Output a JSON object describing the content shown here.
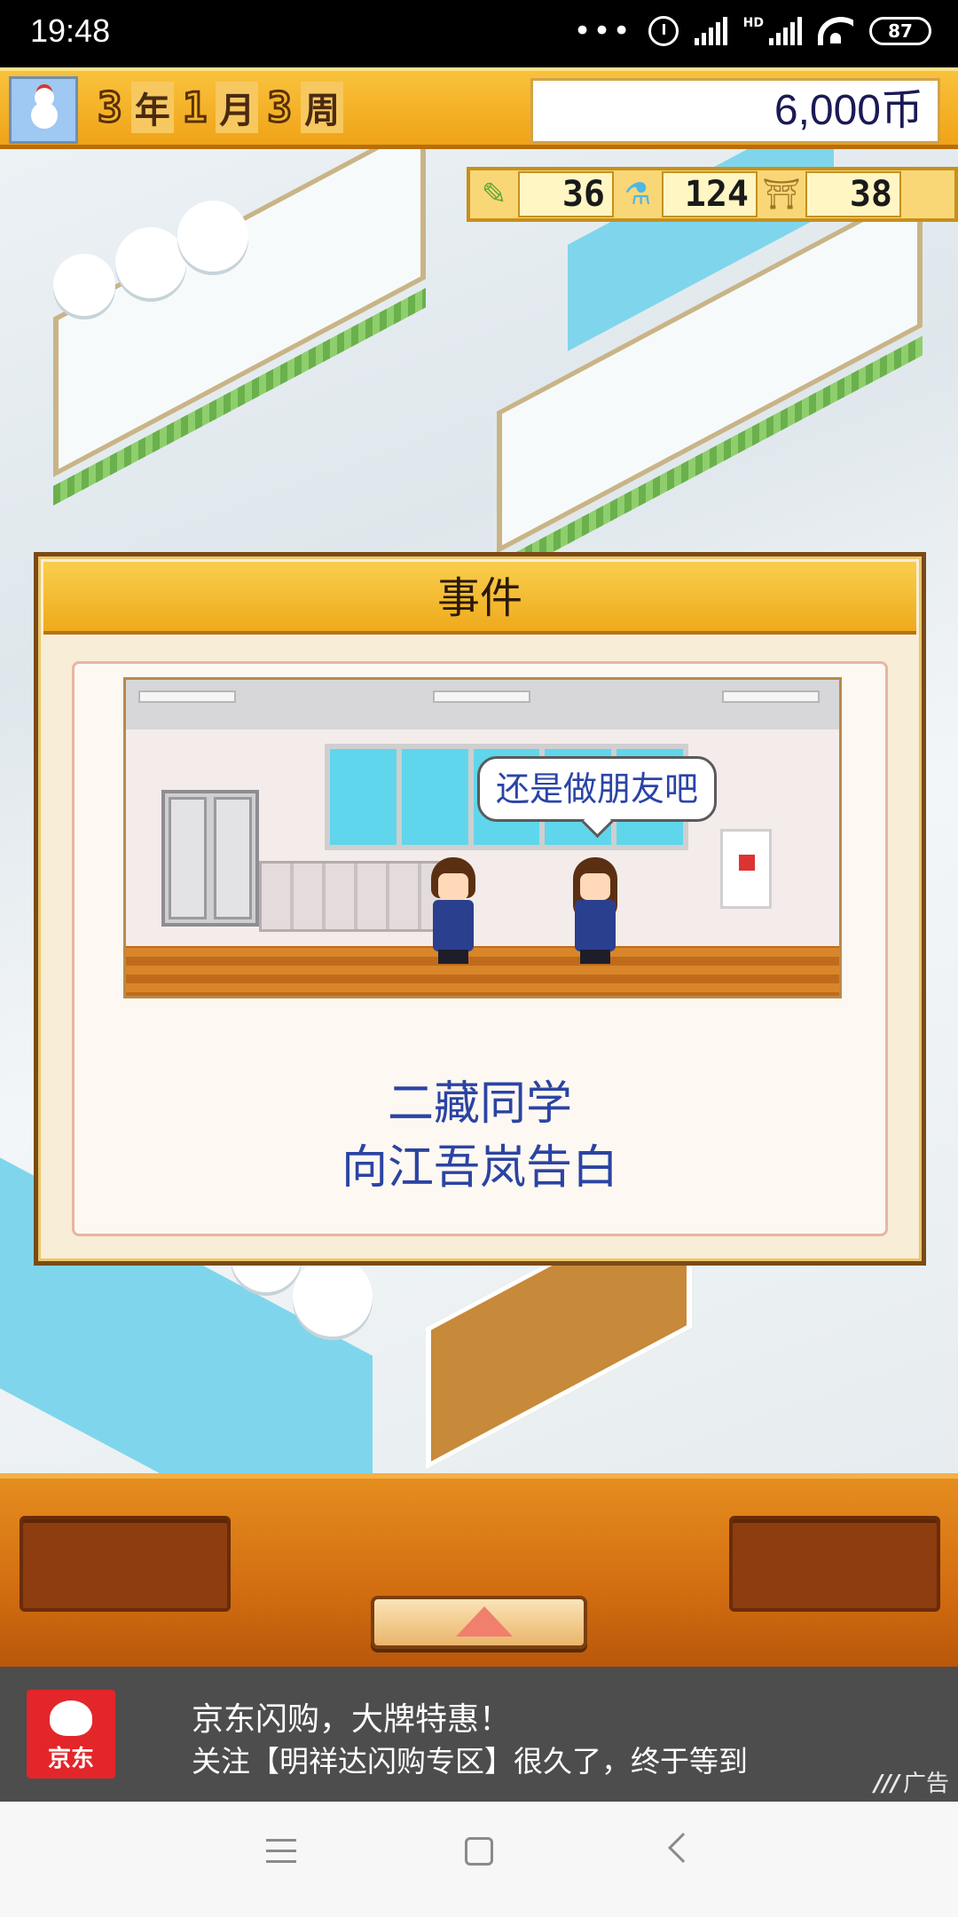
{
  "status_bar": {
    "time": "19:48",
    "battery": "87",
    "network_label": "HD",
    "icons": [
      "more-dots-icon",
      "alarm-icon",
      "signal-icon",
      "signal-hd-icon",
      "wifi-icon",
      "battery-icon"
    ]
  },
  "hud": {
    "avatar_icon": "snowman-icon",
    "date": {
      "year": "3",
      "year_unit": "年",
      "month": "1",
      "month_unit": "月",
      "week": "3",
      "week_unit": "周"
    },
    "coins": "6,000币",
    "stats": [
      {
        "icon": "pencil-icon",
        "value": "36"
      },
      {
        "icon": "flask-icon",
        "value": "124"
      },
      {
        "icon": "bell-icon",
        "value": "38"
      }
    ]
  },
  "event_dialog": {
    "title": "事件",
    "speech": "还是做朋友吧",
    "line1": "二藏同学",
    "line2": "向江吾岚告白"
  },
  "ad": {
    "logo_text": "京东",
    "title": "京东闪购，大牌特惠！",
    "description": "关注【明祥达闪购专区】很久了，终于等到",
    "tag": "广告"
  },
  "colors": {
    "hud_orange": "#f0a317",
    "dialog_header": "#f9ce4d",
    "event_text_blue": "#2b44a3",
    "ad_background": "#4d4d4d",
    "jd_red": "#e3262a"
  }
}
